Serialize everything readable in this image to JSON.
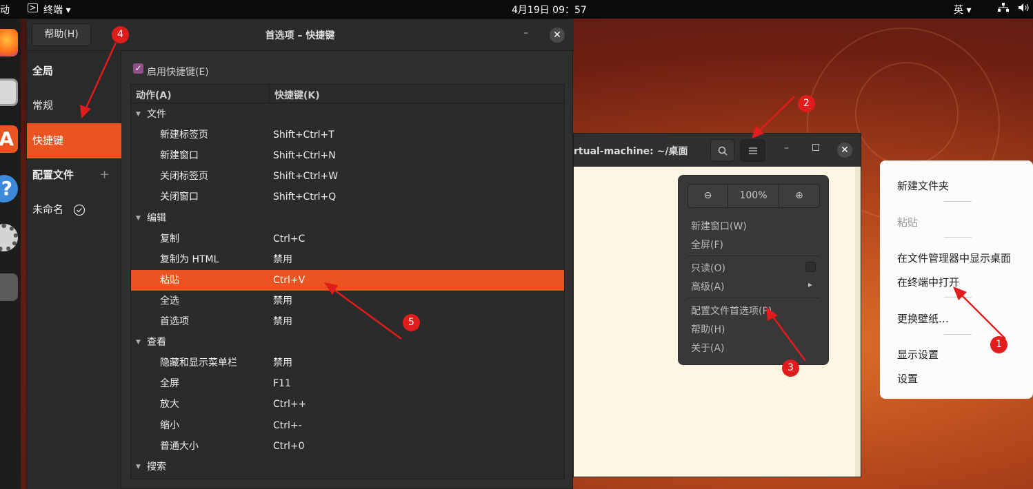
{
  "topbar": {
    "activities": "动",
    "app": "终端",
    "app_arrow": "▾",
    "clock": "4月19日  09：57",
    "ime": "英",
    "ime_arrow": "▾"
  },
  "prefs": {
    "help_button": "帮助(H)",
    "title": "首选项 – 快捷键",
    "minimize": "–",
    "close": "✕",
    "sidebar": [
      {
        "label": "全局",
        "kind": "head"
      },
      {
        "label": "常规",
        "kind": "item"
      },
      {
        "label": "快捷键",
        "kind": "selected"
      },
      {
        "label": "配置文件",
        "kind": "head"
      },
      {
        "label": "未命名",
        "kind": "item"
      }
    ],
    "add_profile": "+",
    "enable_label": "启用快捷键(E)",
    "col_action": "动作(A)",
    "col_key": "快捷键(K)",
    "rows": [
      {
        "action": "文件",
        "key": "",
        "group": true
      },
      {
        "action": "新建标签页",
        "key": "Shift+Ctrl+T"
      },
      {
        "action": "新建窗口",
        "key": "Shift+Ctrl+N"
      },
      {
        "action": "关闭标签页",
        "key": "Shift+Ctrl+W"
      },
      {
        "action": "关闭窗口",
        "key": "Shift+Ctrl+Q"
      },
      {
        "action": "编辑",
        "key": "",
        "group": true
      },
      {
        "action": "复制",
        "key": "Ctrl+C"
      },
      {
        "action": "复制为 HTML",
        "key": "禁用"
      },
      {
        "action": "粘贴",
        "key": "Ctrl+V",
        "selected": true
      },
      {
        "action": "全选",
        "key": "禁用"
      },
      {
        "action": "首选项",
        "key": "禁用"
      },
      {
        "action": "查看",
        "key": "",
        "group": true
      },
      {
        "action": "隐藏和显示菜单栏",
        "key": "禁用"
      },
      {
        "action": "全屏",
        "key": "F11"
      },
      {
        "action": "放大",
        "key": "Ctrl++"
      },
      {
        "action": "缩小",
        "key": "Ctrl+-"
      },
      {
        "action": "普通大小",
        "key": "Ctrl+0"
      },
      {
        "action": "搜索",
        "key": "",
        "group": true
      }
    ]
  },
  "terminal": {
    "title": "rtual-machine: ~/桌面",
    "menu": {
      "zoom_out": "⊖",
      "zoom": "100%",
      "zoom_in": "⊕",
      "new_window": "新建窗口(W)",
      "fullscreen": "全屏(F)",
      "readonly": "只读(O)",
      "advanced": "高级(A)",
      "submenu_arrow": "▸",
      "profile_prefs": "配置文件首选项(P)",
      "help": "帮助(H)",
      "about": "关于(A)"
    }
  },
  "desktop_menu": {
    "new_folder": "新建文件夹",
    "paste": "粘贴",
    "show_in_files": "在文件管理器中显示桌面",
    "open_terminal": "在终端中打开",
    "wallpaper": "更换壁纸…",
    "display_settings": "显示设置",
    "settings": "设置"
  },
  "annotations": [
    "1",
    "2",
    "3",
    "4",
    "5"
  ],
  "colors": {
    "accent": "#e95420",
    "checkbox": "#924d8b",
    "badge": "#e11c1c",
    "terminal_bg": "#fdf6e3"
  }
}
